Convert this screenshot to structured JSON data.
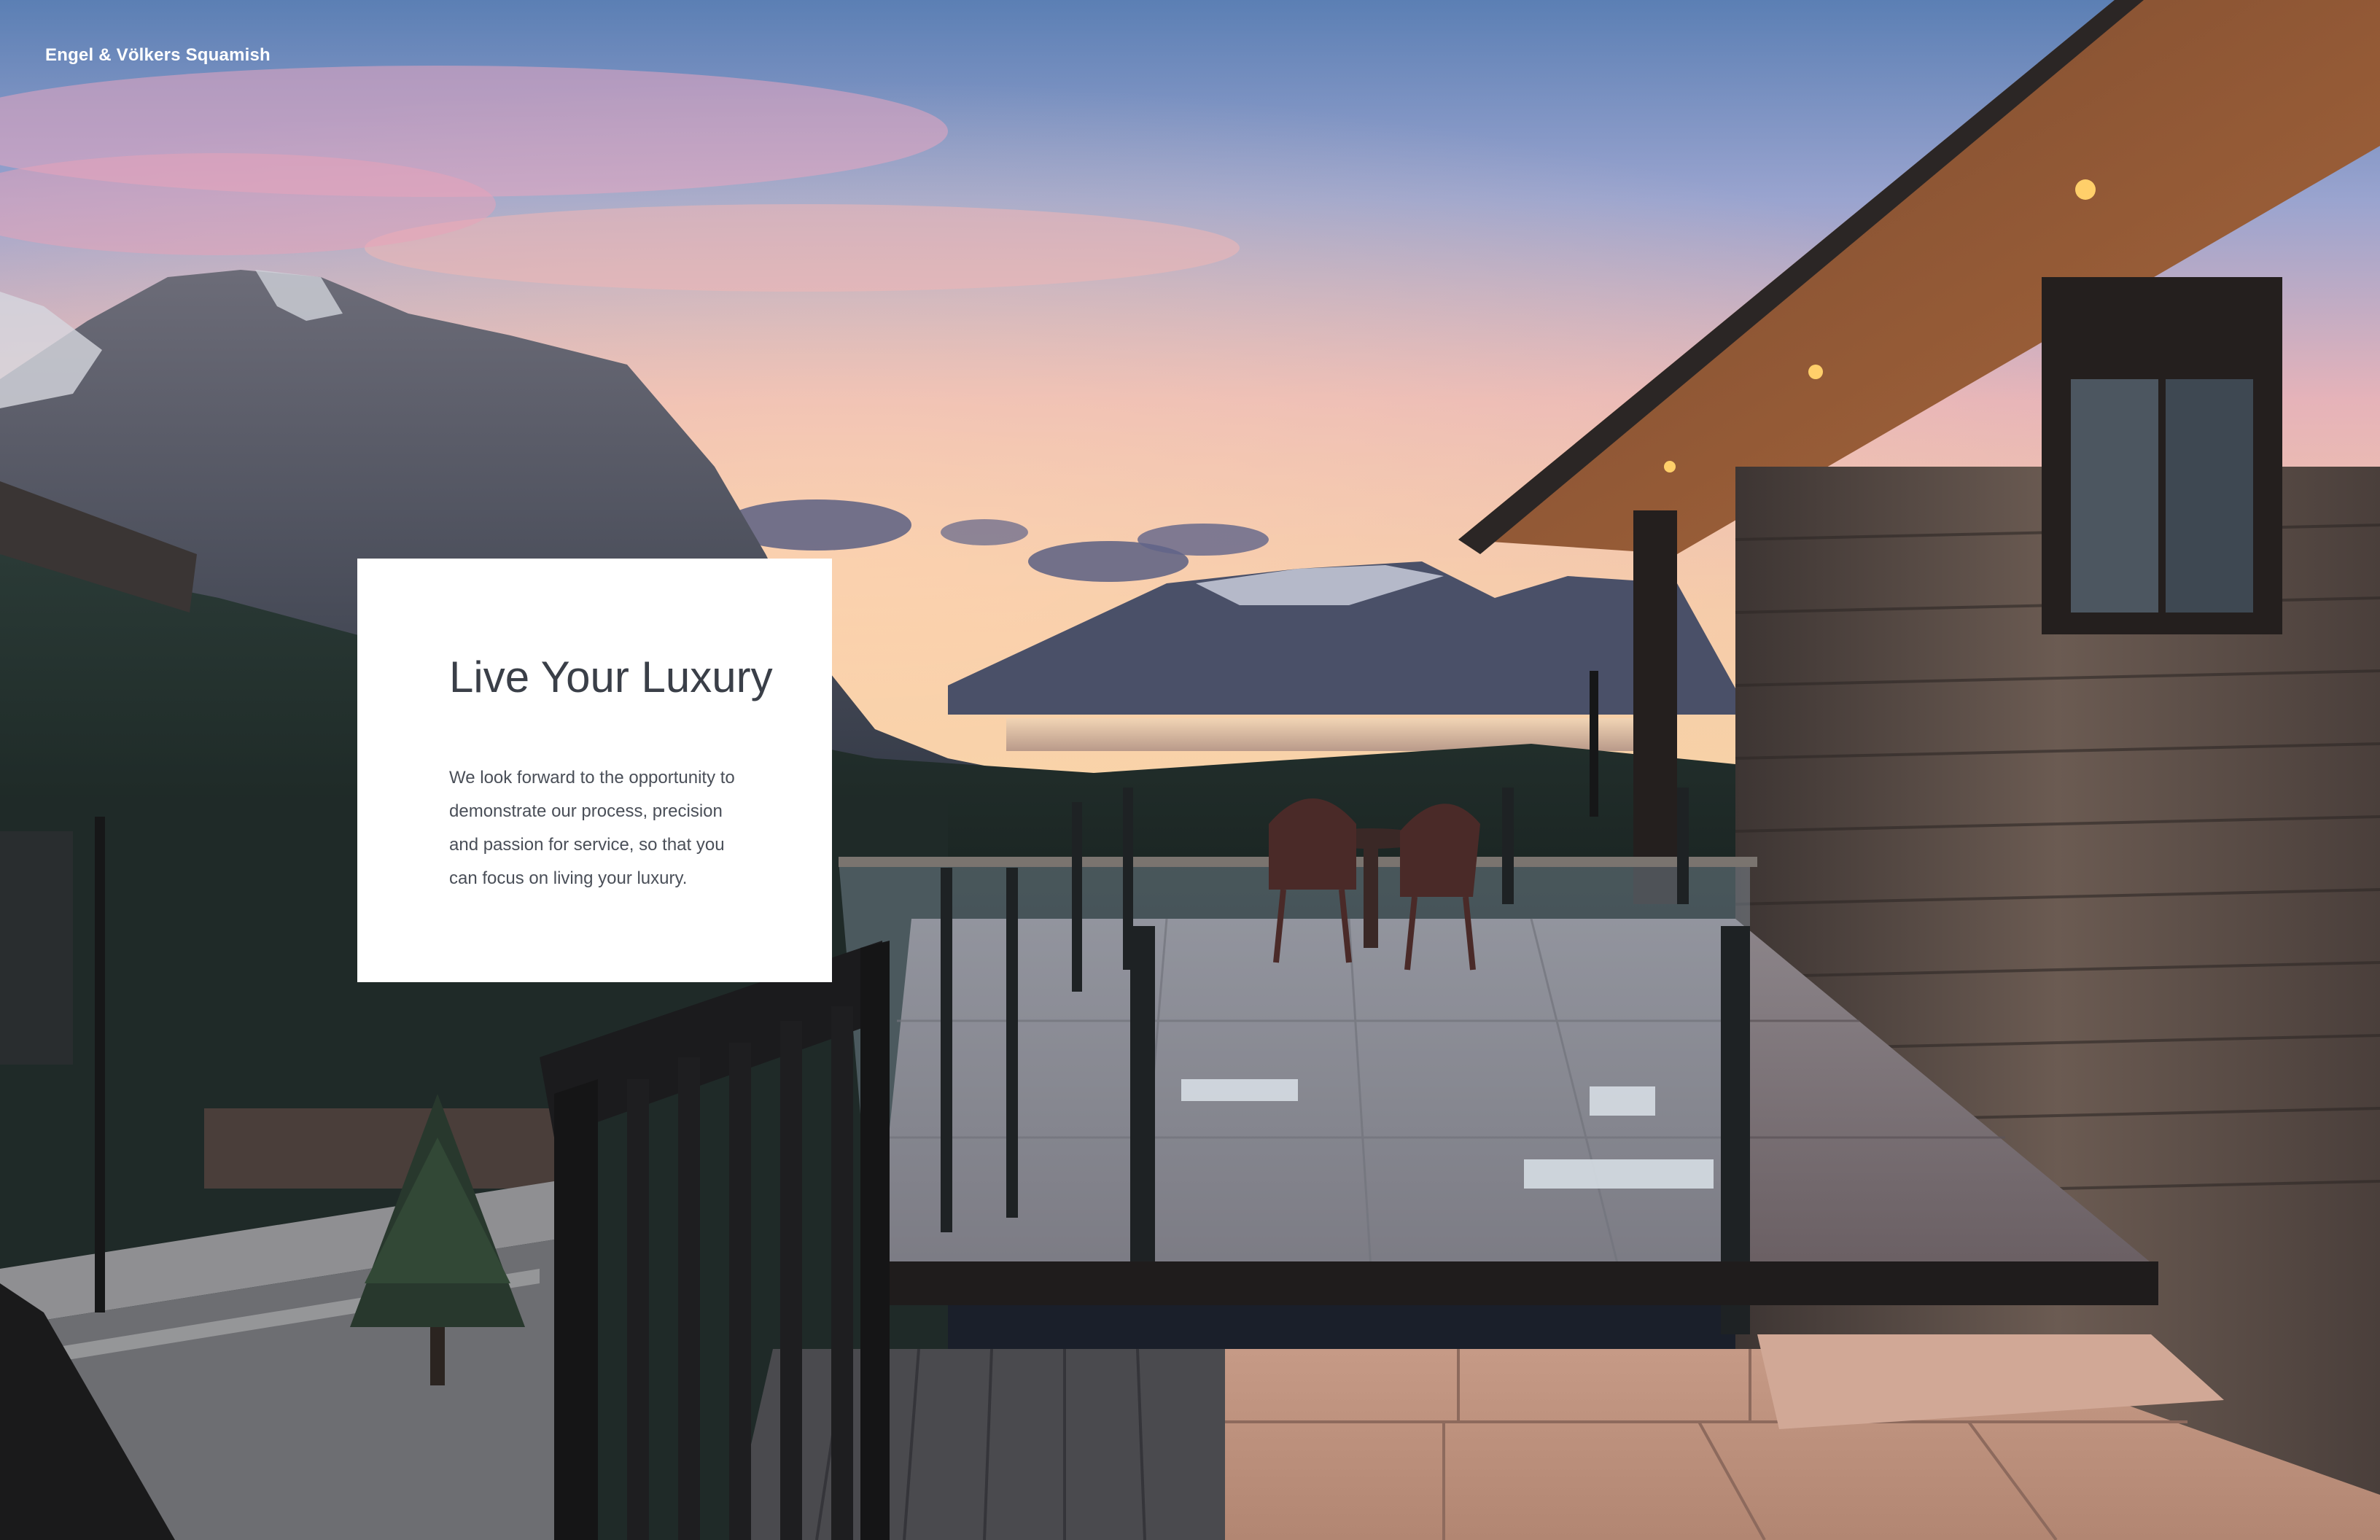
{
  "brand": {
    "name": "Engel & Völkers Squamish"
  },
  "card": {
    "title": "Live Your Luxury",
    "body_lines": [
      "We look forward to the opportunity to",
      "demonstrate our process, precision",
      "and passion for service, so that you",
      "can focus on living your luxury."
    ]
  },
  "colors": {
    "card_background": "#ffffff",
    "title_text": "#3a3f48",
    "body_text": "#4a4f58",
    "brand_text": "#ffffff"
  }
}
